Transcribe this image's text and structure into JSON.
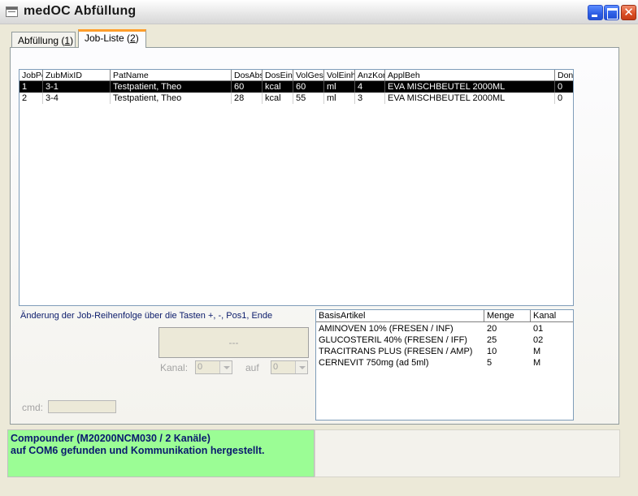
{
  "window": {
    "title": "medOC Abfüllung",
    "close_glyph": "✕"
  },
  "tabs": [
    {
      "label_pre": "Abfüllung (",
      "accel": "1",
      "label_post": ")",
      "active": false
    },
    {
      "label_pre": "Job-Liste (",
      "accel": "2",
      "label_post": ")",
      "active": true
    }
  ],
  "job_table": {
    "columns": [
      "JobPos",
      "ZubMixID",
      "PatName",
      "DosAbs",
      "DosEinh",
      "VolGes",
      "VolEinh",
      "AnzKomp",
      "ApplBeh",
      "Done"
    ],
    "rows": [
      [
        "1",
        "3-1",
        "Testpatient, Theo",
        "60",
        "kcal",
        "60",
        "ml",
        "4",
        "EVA MISCHBEUTEL 2000ML",
        "0"
      ],
      [
        "2",
        "3-4",
        "Testpatient, Theo",
        "28",
        "kcal",
        "55",
        "ml",
        "3",
        "EVA MISCHBEUTEL 2000ML",
        "0"
      ]
    ],
    "selected_row": 0
  },
  "hint_text": "Änderung der Job-Reihenfolge über die Tasten  +,  -,  Pos1,  Ende",
  "action_display": "---",
  "kanal": {
    "label": "Kanal:",
    "value": "0"
  },
  "auf": {
    "label": "auf",
    "value": "0"
  },
  "cmd": {
    "label": "cmd:",
    "value": ""
  },
  "basis_table": {
    "columns": [
      "BasisArtikel",
      "Menge",
      "Kanal"
    ],
    "rows": [
      [
        "AMINOVEN 10% (FRESEN / INF)",
        "20",
        "01"
      ],
      [
        "GLUCOSTERIL 40%  (FRESEN / IFF)",
        "25",
        "02"
      ],
      [
        "TRACITRANS PLUS (FRESEN / AMP)",
        "10",
        "M"
      ],
      [
        "CERNEVIT 750mg (ad 5ml)",
        "5",
        "M"
      ]
    ]
  },
  "status": {
    "line1": "Compounder (M20200NCM030  / 2 Kanäle)",
    "line2": "auf COM6 gefunden und Kommunikation hergestellt.",
    "color": "#9bfd95"
  }
}
